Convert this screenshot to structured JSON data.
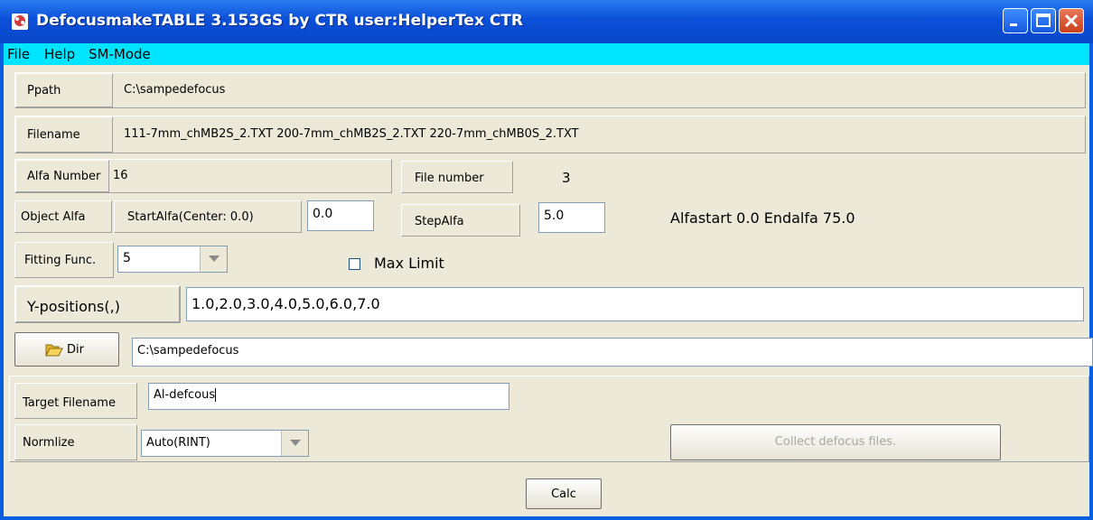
{
  "window": {
    "title": "DefocusmakeTABLE 3.153GS by CTR  user:HelperTex CTR"
  },
  "menu": {
    "file": "File",
    "help": "Help",
    "sm_mode": "SM-Mode"
  },
  "ppath": {
    "label": "Ppath",
    "value": "C:\\sampedefocus"
  },
  "filename": {
    "label": "Filename",
    "value": "111-7mm_chMB2S_2.TXT 200-7mm_chMB2S_2.TXT 220-7mm_chMB0S_2.TXT"
  },
  "alfa_number": {
    "label": "Alfa Number",
    "value": "16"
  },
  "file_number": {
    "label": "File number",
    "value": "3"
  },
  "object_alfa": {
    "label": "Object Alfa",
    "start_label": "StartAlfa(Center: 0.0)",
    "start_value": "0.0",
    "step_label": "StepAlfa",
    "step_value": "5.0",
    "summary": "Alfastart 0.0 Endalfa 75.0"
  },
  "fitting": {
    "label": "Fitting Func.",
    "value": "5",
    "max_limit_label": "Max Limit",
    "max_limit_checked": false
  },
  "y_positions": {
    "label": "Y-positions(,)",
    "value": "1.0,2.0,3.0,4.0,5.0,6.0,7.0"
  },
  "dir": {
    "button_label": "Dir",
    "value": "C:\\sampedefocus"
  },
  "target": {
    "label": "Target Filename",
    "value": "Al-defcous"
  },
  "normalize": {
    "label": "Normlize",
    "value": "Auto(RINT)",
    "collect_button": "Collect defocus files."
  },
  "calc_button": "Calc",
  "icons": {
    "app": "app-icon",
    "folder": "folder-open-icon",
    "minimize": "minimize-icon",
    "maximize": "maximize-icon",
    "close": "close-icon"
  },
  "colors": {
    "titlebar": "#0b4fd8",
    "menubar": "#00e5ff",
    "client": "#ece9d8"
  }
}
